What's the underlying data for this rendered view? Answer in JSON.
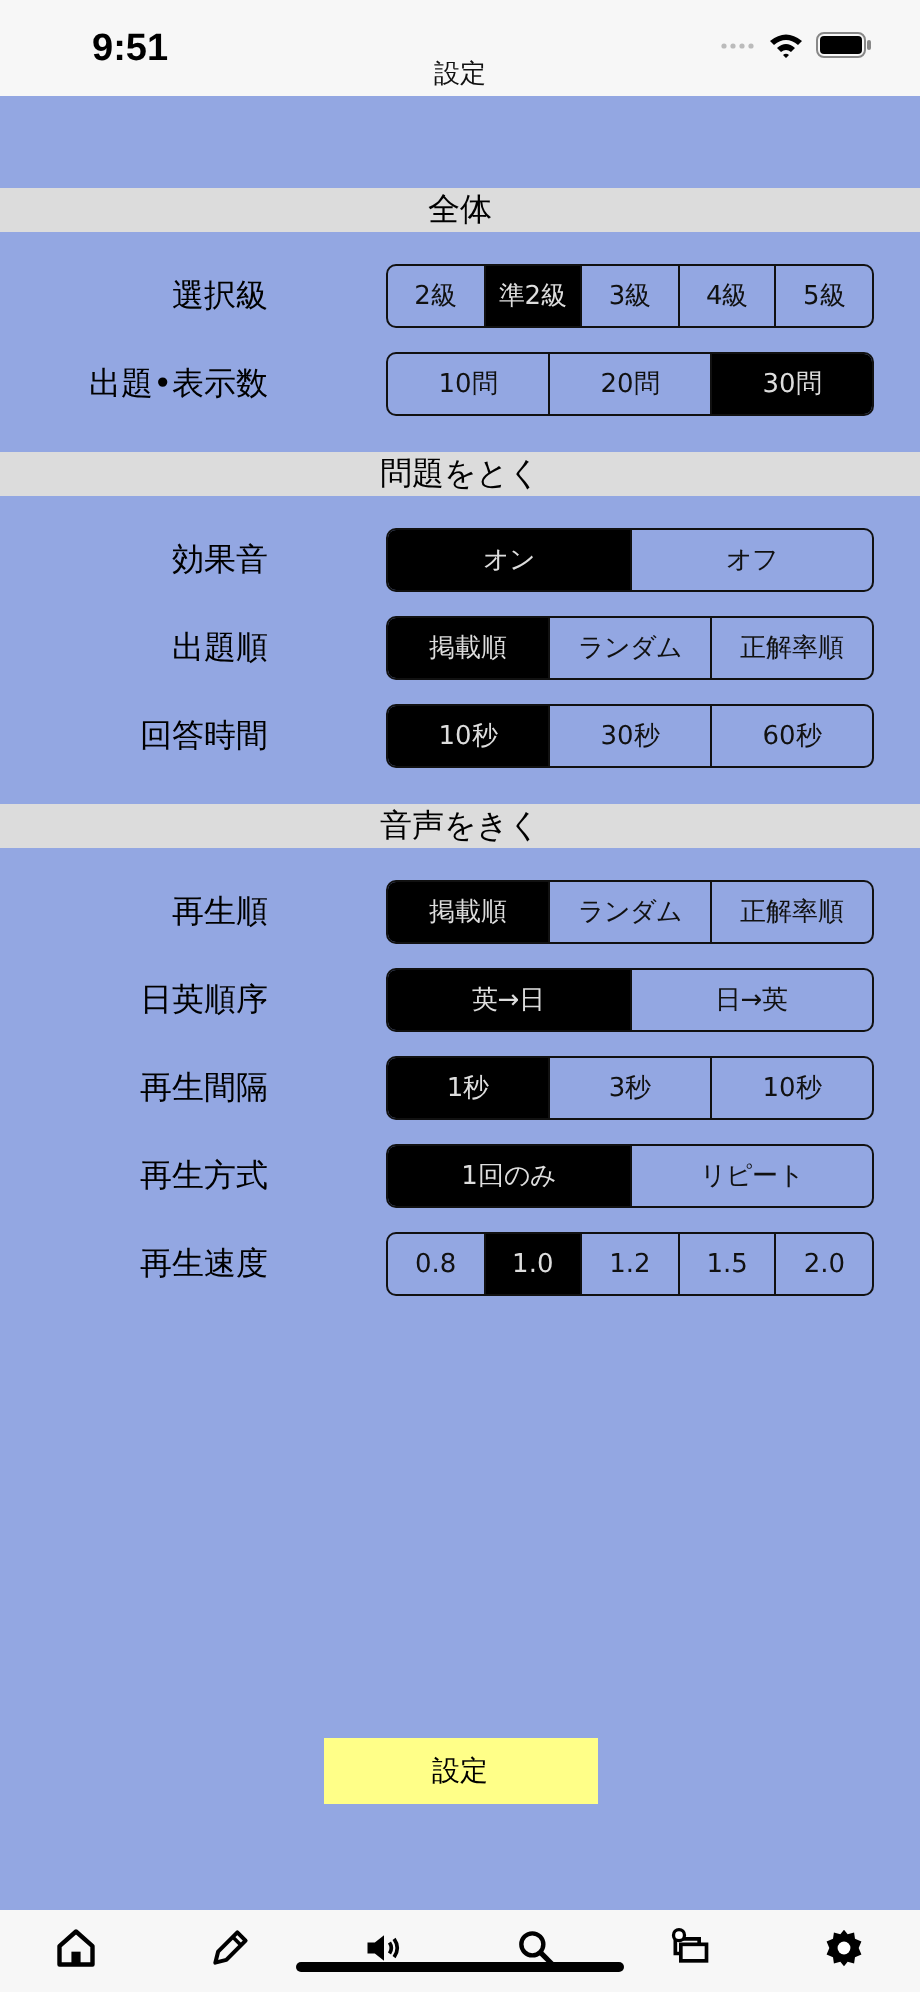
{
  "status_bar": {
    "time": "9:51"
  },
  "nav": {
    "title": "設定"
  },
  "sections": [
    {
      "title": "全体",
      "rows": [
        {
          "label": "選択級",
          "options": [
            {
              "label": "2級",
              "selected": false
            },
            {
              "label": "準2級",
              "selected": true
            },
            {
              "label": "3級",
              "selected": false
            },
            {
              "label": "4級",
              "selected": false
            },
            {
              "label": "5級",
              "selected": false
            }
          ]
        },
        {
          "label": "出題•表示数",
          "options": [
            {
              "label": "10問",
              "selected": false
            },
            {
              "label": "20問",
              "selected": false
            },
            {
              "label": "30問",
              "selected": true
            }
          ]
        }
      ]
    },
    {
      "title": "問題をとく",
      "rows": [
        {
          "label": "効果音",
          "options": [
            {
              "label": "オン",
              "selected": true
            },
            {
              "label": "オフ",
              "selected": false
            }
          ]
        },
        {
          "label": "出題順",
          "options": [
            {
              "label": "掲載順",
              "selected": true
            },
            {
              "label": "ランダム",
              "selected": false
            },
            {
              "label": "正解率順",
              "selected": false
            }
          ]
        },
        {
          "label": "回答時間",
          "options": [
            {
              "label": "10秒",
              "selected": true
            },
            {
              "label": "30秒",
              "selected": false
            },
            {
              "label": "60秒",
              "selected": false
            }
          ]
        }
      ]
    },
    {
      "title": "音声をきく",
      "rows": [
        {
          "label": "再生順",
          "options": [
            {
              "label": "掲載順",
              "selected": true
            },
            {
              "label": "ランダム",
              "selected": false
            },
            {
              "label": "正解率順",
              "selected": false
            }
          ]
        },
        {
          "label": "日英順序",
          "options": [
            {
              "label": "英→日",
              "selected": true
            },
            {
              "label": "日→英",
              "selected": false
            }
          ]
        },
        {
          "label": "再生間隔",
          "options": [
            {
              "label": "1秒",
              "selected": true
            },
            {
              "label": "3秒",
              "selected": false
            },
            {
              "label": "10秒",
              "selected": false
            }
          ]
        },
        {
          "label": "再生方式",
          "options": [
            {
              "label": "1回のみ",
              "selected": true
            },
            {
              "label": "リピート",
              "selected": false
            }
          ]
        },
        {
          "label": "再生速度",
          "options": [
            {
              "label": "0.8",
              "selected": false
            },
            {
              "label": "1.0",
              "selected": true
            },
            {
              "label": "1.2",
              "selected": false
            },
            {
              "label": "1.5",
              "selected": false
            },
            {
              "label": "2.0",
              "selected": false
            }
          ]
        }
      ]
    }
  ],
  "submit_button": "設定",
  "tab_bar": [
    {
      "kind": "home"
    },
    {
      "kind": "pencil"
    },
    {
      "kind": "speaker"
    },
    {
      "kind": "search"
    },
    {
      "kind": "cards"
    },
    {
      "kind": "settings"
    }
  ]
}
